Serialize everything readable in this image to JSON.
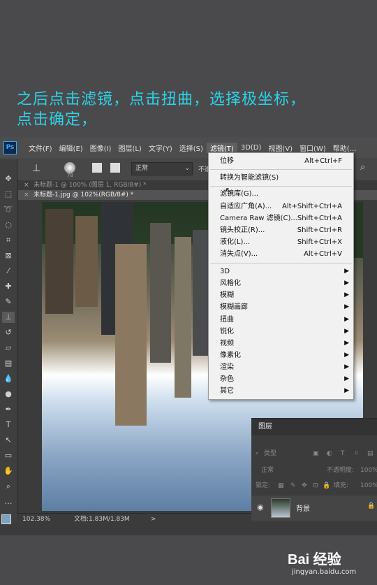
{
  "caption": {
    "line1": "之后点击滤镜，点击扭曲，选择极坐标，",
    "line2": "点击确定，"
  },
  "app": {
    "logo_text": "Ps",
    "menus": [
      "文件(F)",
      "编辑(E)",
      "图像(I)",
      "图层(L)",
      "文字(Y)",
      "选择(S)",
      "滤镜(T)",
      "3D(D)",
      "视图(V)",
      "窗口(W)",
      "帮助(…"
    ],
    "active_menu_index": 6
  },
  "options": {
    "brush_size": "78",
    "blend_mode": "正常",
    "opacity_label": "不透"
  },
  "tabs": {
    "background_doc": "未标题-1 @ 100% (图层 1, RGB/8#) *",
    "active_doc": "未标题-1.jpg @ 102%(RGB/8#) *"
  },
  "status": {
    "zoom": "102.38%",
    "doc_size": "文档:1.83M/1.83M",
    "arrow": ">"
  },
  "filter_menu": {
    "items": [
      {
        "label": "位移",
        "shortcut": "Alt+Ctrl+F"
      },
      {
        "label": "转换为智能滤镜(S)",
        "shortcut": ""
      },
      {
        "label": "滤镜库(G)...",
        "shortcut": ""
      },
      {
        "label": "自适应广角(A)...",
        "shortcut": "Alt+Shift+Ctrl+A"
      },
      {
        "label": "Camera Raw 滤镜(C)...",
        "shortcut": "Shift+Ctrl+A"
      },
      {
        "label": "镜头校正(R)...",
        "shortcut": "Shift+Ctrl+R"
      },
      {
        "label": "液化(L)...",
        "shortcut": "Shift+Ctrl+X"
      },
      {
        "label": "消失点(V)...",
        "shortcut": "Alt+Ctrl+V"
      },
      {
        "label": "3D",
        "shortcut": ""
      },
      {
        "label": "风格化",
        "shortcut": ""
      },
      {
        "label": "模糊",
        "shortcut": ""
      },
      {
        "label": "模糊画廊",
        "shortcut": ""
      },
      {
        "label": "扭曲",
        "shortcut": ""
      },
      {
        "label": "锐化",
        "shortcut": ""
      },
      {
        "label": "视频",
        "shortcut": ""
      },
      {
        "label": "像素化",
        "shortcut": ""
      },
      {
        "label": "渲染",
        "shortcut": ""
      },
      {
        "label": "杂色",
        "shortcut": ""
      },
      {
        "label": "其它",
        "shortcut": ""
      }
    ],
    "submenu_arrow": "▶"
  },
  "layers_panel": {
    "title": "图层",
    "filter_kind": "类型",
    "blend_mode": "正常",
    "opacity_label": "不透明度:",
    "opacity_value": "100%",
    "lock_label": "锁定:",
    "fill_label": "填充:",
    "fill_value": "100%",
    "layer_name": "背景"
  },
  "watermark": {
    "logo": "Bai 经验",
    "site": "jingyan.baidu.com"
  },
  "colors": {
    "caption": "#2fd0e6",
    "app_bg": "#3b3b3b",
    "menu_bg": "#f1f1f1",
    "accent": "#31a8ff"
  }
}
